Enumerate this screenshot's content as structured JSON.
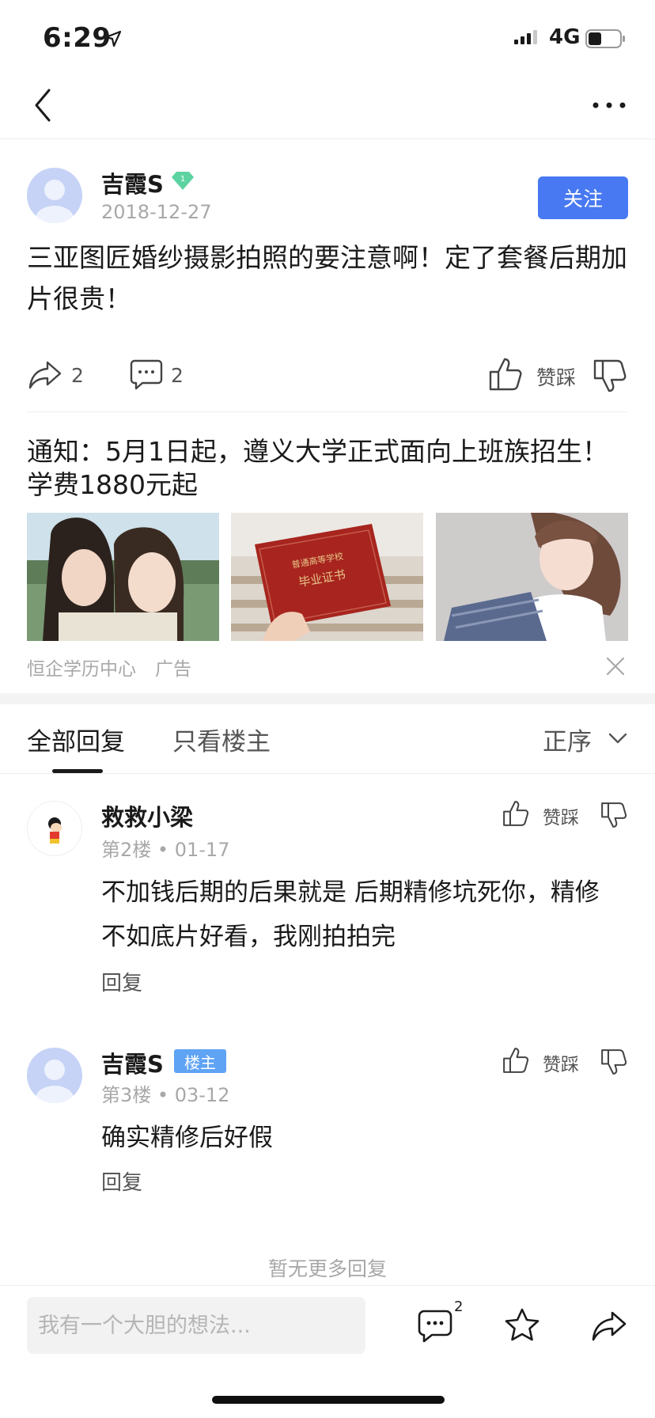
{
  "status": {
    "time": "6:29",
    "network": "4G"
  },
  "post": {
    "author": "吉霞S",
    "vip_level": "1",
    "date": "2018-12-27",
    "follow_label": "关注",
    "body": "三亚图匠婚纱摄影拍照的要注意啊！定了套餐后期加片很贵！",
    "share_count": "2",
    "comment_count": "2",
    "vote_label": "赞踩"
  },
  "ad": {
    "title": "通知：5月1日起，遵义大学正式面向上班族招生！学费1880元起",
    "certificate_text_top": "普通高等学校",
    "certificate_text_main": "毕业证书",
    "source": "恒企学历中心",
    "label": "广告"
  },
  "tabs": {
    "all": "全部回复",
    "op_only": "只看楼主",
    "sort": "正序"
  },
  "replies": [
    {
      "name": "救救小梁",
      "floor": "第2楼",
      "date": "01-17",
      "text": "不加钱后期的后果就是 后期精修坑死你，精修不如底片好看，我刚拍拍完",
      "reply_label": "回复",
      "vote_label": "赞踩"
    },
    {
      "name": "吉霞S",
      "badge": "楼主",
      "floor": "第3楼",
      "date": "03-12",
      "text": "确实精修后好假",
      "reply_label": "回复",
      "vote_label": "赞踩"
    }
  ],
  "footer_note": "暂无更多回复",
  "bottom": {
    "placeholder": "我有一个大胆的想法...",
    "comment_badge": "2"
  },
  "colors": {
    "accent": "#4879f2",
    "op_badge": "#5fa3f4",
    "vip": "#5cd3a0",
    "muted": "#a8a8a8"
  }
}
